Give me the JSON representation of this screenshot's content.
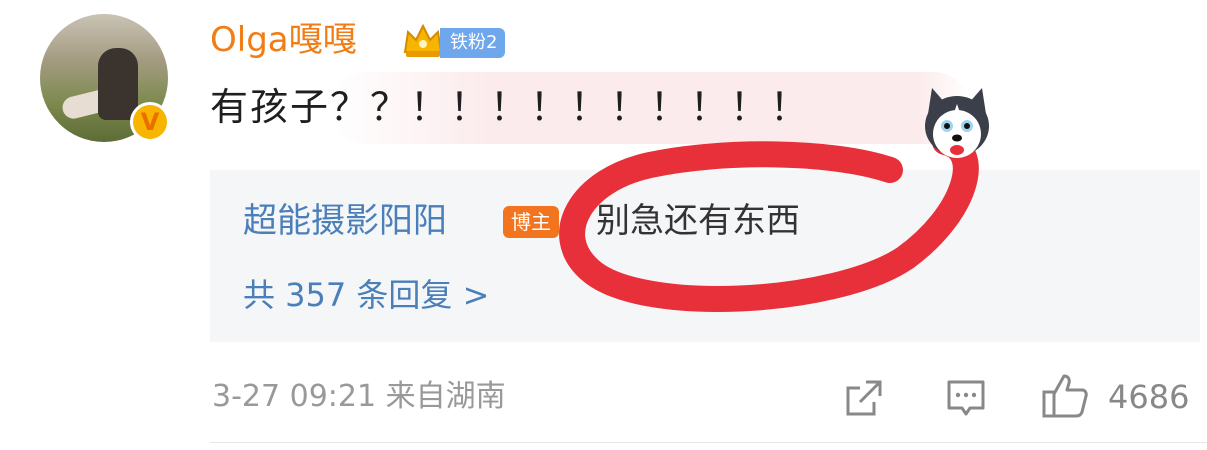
{
  "comment": {
    "username": "Olga嘎嘎",
    "fan_badge": "铁粉2",
    "text": "有孩子？？！！！！！！！！！！",
    "icons": [
      "avatar",
      "verified-icon",
      "crown-icon",
      "husky-sticker-icon"
    ],
    "colors": {
      "username": "#f07d15",
      "fan_badge": "#6ea7ec"
    }
  },
  "reply": {
    "author": "超能摄影阳阳",
    "author_badge": "博主",
    "text": "别急还有东西",
    "count_label": "共 357 条回复 >",
    "colors": {
      "author": "#4a7fb9",
      "badge": "#f3741f",
      "box": "#f5f6f8"
    }
  },
  "footer": {
    "time": "3-27 09:21 来自湖南",
    "like_count": "4686",
    "icons": [
      "share-icon",
      "comment-icon",
      "like-icon"
    ]
  },
  "annotation": {
    "color": "#e8303a",
    "kind": "hand-drawn circle"
  }
}
